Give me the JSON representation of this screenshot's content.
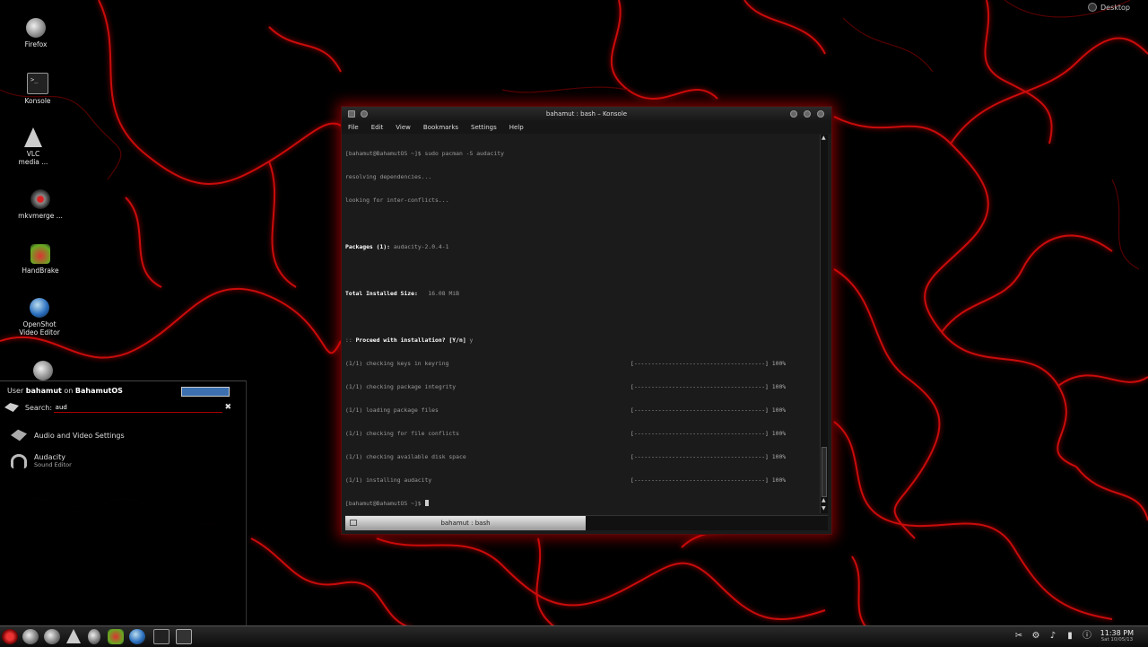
{
  "desktop": {
    "label": "Desktop",
    "icons": [
      {
        "label": "Firefox",
        "icon": "firefox-icon"
      },
      {
        "label": "Konsole",
        "icon": "konsole-icon"
      },
      {
        "label": "VLC media ...",
        "icon": "vlc-icon"
      },
      {
        "label": "mkvmerge ...",
        "icon": "mkvmerge-icon"
      },
      {
        "label": "HandBrake",
        "icon": "handbrake-icon"
      },
      {
        "label": "OpenShot Video Editor",
        "icon": "openshot-icon"
      }
    ]
  },
  "launcher": {
    "user_prefix": "User",
    "user": "bahamut",
    "on": "on",
    "host": "BahamutOS",
    "search_label": "Search:",
    "search_value": "aud",
    "results": [
      {
        "title": "Audio and Video Settings",
        "subtitle": ""
      },
      {
        "title": "Audacity",
        "subtitle": "Sound Editor"
      }
    ]
  },
  "konsole": {
    "title": "bahamut : bash – Konsole",
    "menu": [
      "File",
      "Edit",
      "View",
      "Bookmarks",
      "Settings",
      "Help"
    ],
    "lines": {
      "l1": "[bahamut@BahamutOS ~]$ sudo pacman -S audacity",
      "l2": "resolving dependencies...",
      "l3": "looking for inter-conflicts...",
      "packages_label": "Packages (1):",
      "packages_value": "audacity-2.0.4-1",
      "size_label": "Total Installed Size:",
      "size_value": "16.08 MiB",
      "proceed_prefix": "::",
      "proceed_text": "Proceed with installation? [Y/n]",
      "proceed_answer": "y",
      "steps": [
        "(1/1) checking keys in keyring",
        "(1/1) checking package integrity",
        "(1/1) loading package files",
        "(1/1) checking for file conflicts",
        "(1/1) checking available disk space",
        "(1/1) installing audacity"
      ],
      "progress": "[--------------------------------------] 100%",
      "prompt": "[bahamut@BahamutOS ~]$"
    },
    "tab_label": "bahamut : bash"
  },
  "taskbar": {
    "time": "11:38 PM",
    "date": "Sat 10/05/13"
  },
  "colors": {
    "accent": "#cc0000",
    "background": "#000000"
  }
}
